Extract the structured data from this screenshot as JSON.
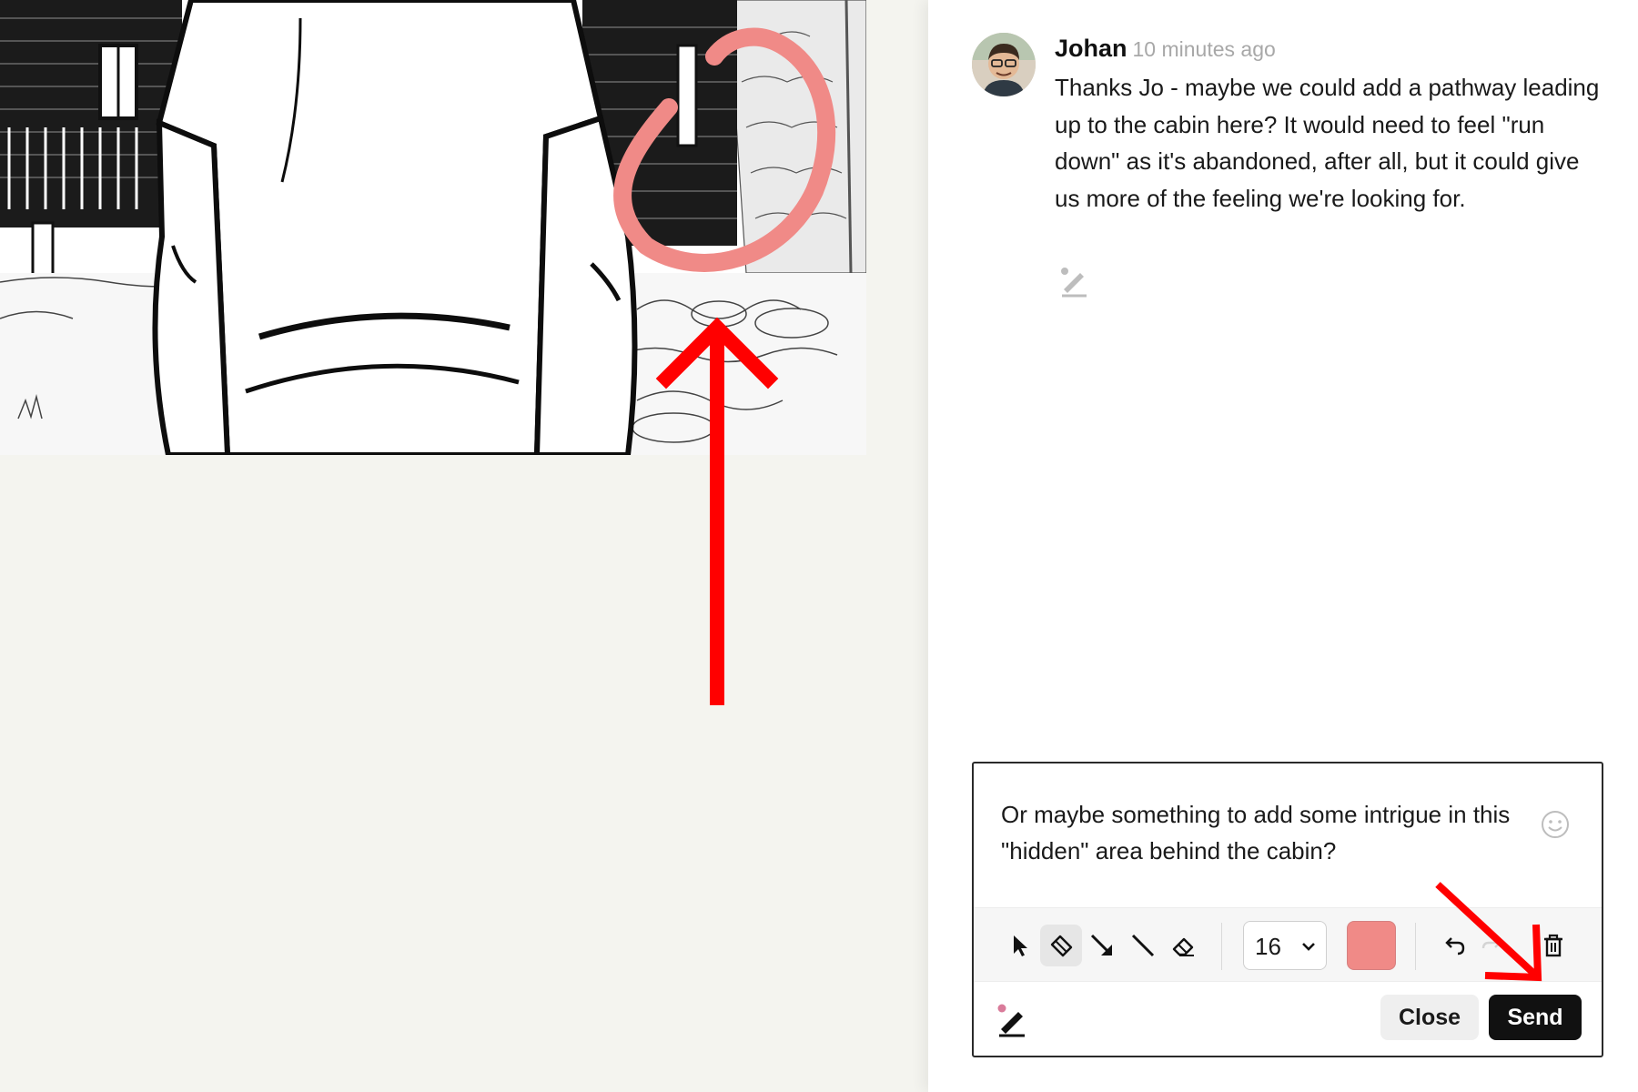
{
  "comment": {
    "author": "Johan",
    "time": "10 minutes ago",
    "body": "Thanks Jo - maybe we could add a pathway leading up to the cabin here? It would need to feel \"run down\" as it's abandoned, after all, but it could give us more of the feeling we're looking for.",
    "avatar_icon": "avatar-photo",
    "marker_icon": "pen-drawing-icon"
  },
  "composer": {
    "text": "Or maybe something to add some intrigue in this \"hidden\" area behind the cabin?",
    "emoji_icon": "smiley-icon",
    "toolbar": {
      "tools": [
        "pointer-icon",
        "pen-icon",
        "arrow-icon",
        "line-icon",
        "eraser-icon"
      ],
      "active_tool": "pen-icon",
      "size_value": "16",
      "color": "#f08a87",
      "undo_icon": "undo-icon",
      "redo_icon": "redo-icon",
      "delete_icon": "trash-icon"
    },
    "close_label": "Close",
    "send_label": "Send"
  },
  "colors": {
    "annotation_arrow": "#ff0000",
    "sketch_circle": "#f08a87",
    "send_button": "#111111"
  }
}
